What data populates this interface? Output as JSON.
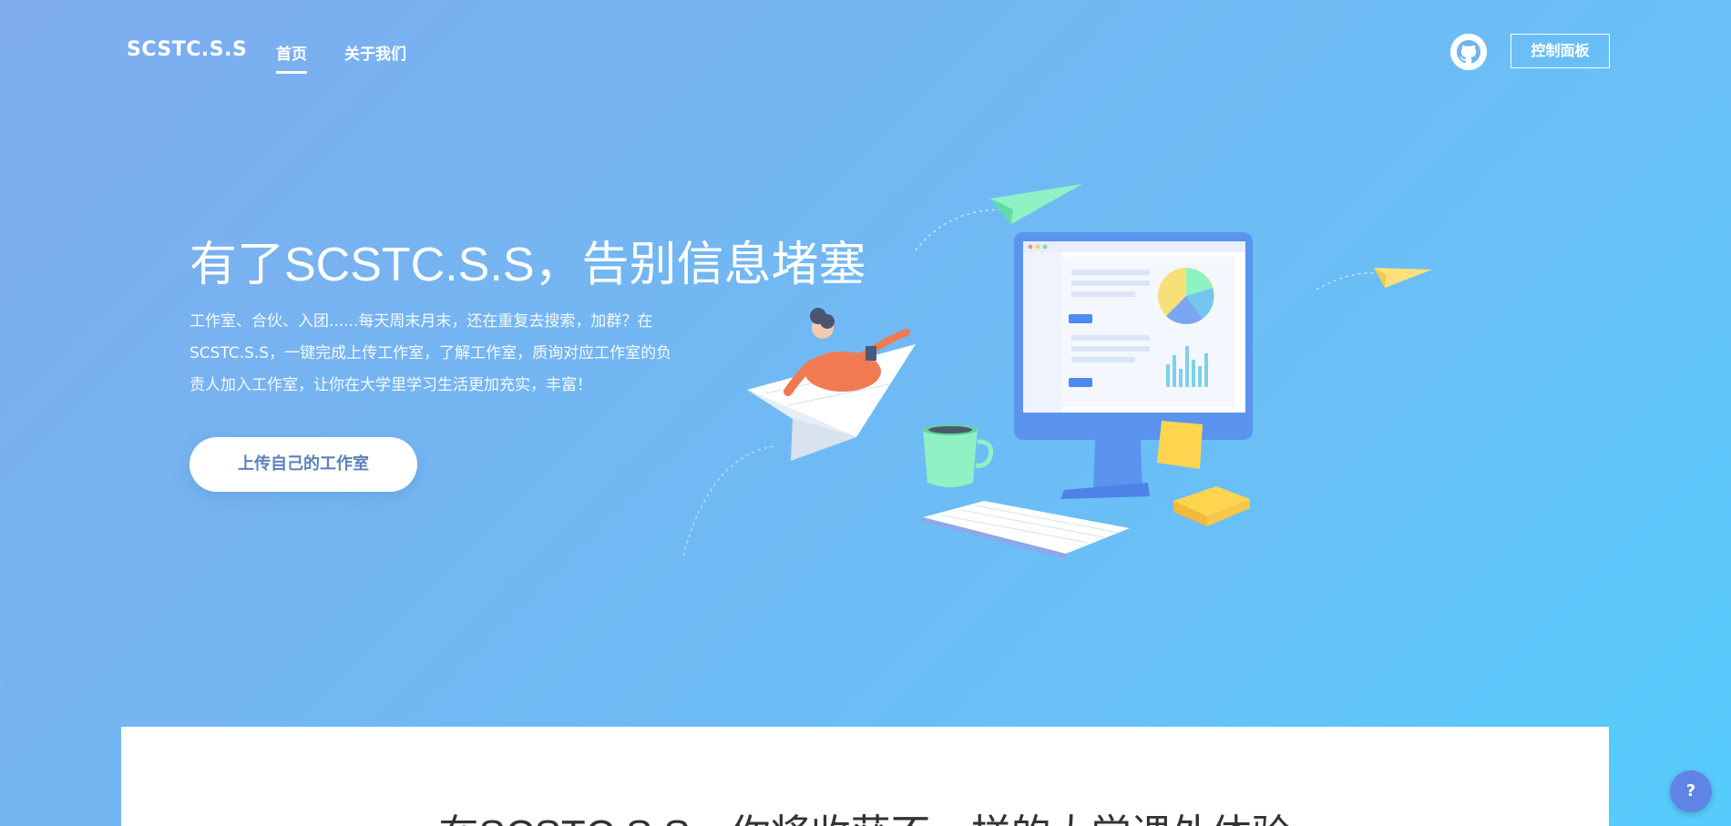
{
  "nav": {
    "brand": "SCSTC.S.S",
    "links": [
      {
        "label": "首页",
        "active": true
      },
      {
        "label": "关于我们",
        "active": false
      }
    ],
    "github_icon": "github-icon",
    "dashboard_label": "控制面板"
  },
  "hero": {
    "title": "有了SCSTC.S.S，告别信息堵塞",
    "description_lines": [
      "工作室、合伙、入团......每天周末月末，还在重复去搜索，加群？在",
      "SCSTC.S.S，一键完成上传工作室，了解工作室，质询对应工作室的负",
      "责人加入工作室，让你在大学里学习生活更加充实，丰富！"
    ],
    "cta_label": "上传自己的工作室"
  },
  "section": {
    "title": "在SCSTC.S.S，你将收获不一样的大学课外体验"
  },
  "help": {
    "label": "?",
    "icon": "help-icon"
  },
  "colors": {
    "gradient_start": "#7facee",
    "gradient_end": "#55cdfc",
    "cta_text": "#5a83b8",
    "help_bg": "#5f84e6"
  }
}
